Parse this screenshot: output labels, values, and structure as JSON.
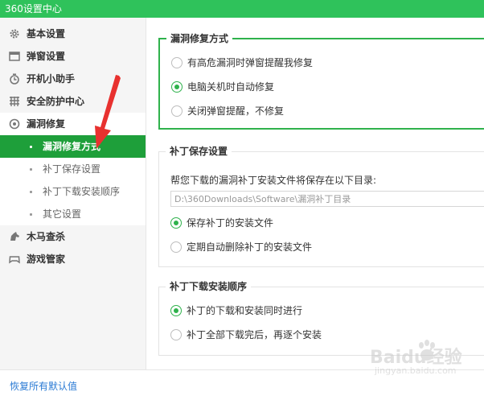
{
  "window": {
    "title": "360设置中心"
  },
  "sidebar": {
    "items": [
      {
        "label": "基本设置",
        "icon": "gear-icon"
      },
      {
        "label": "弹窗设置",
        "icon": "window-icon"
      },
      {
        "label": "开机小助手",
        "icon": "timer-icon"
      },
      {
        "label": "安全防护中心",
        "icon": "shield-grid-icon"
      },
      {
        "label": "漏洞修复",
        "icon": "patch-icon"
      },
      {
        "label": "木马查杀",
        "icon": "horse-icon"
      },
      {
        "label": "游戏管家",
        "icon": "gamepad-icon"
      }
    ],
    "subitems": [
      {
        "label": "漏洞修复方式",
        "active": true
      },
      {
        "label": "补丁保存设置"
      },
      {
        "label": "补丁下载安装顺序"
      },
      {
        "label": "其它设置"
      }
    ]
  },
  "groups": {
    "repair_mode": {
      "title": "漏洞修复方式",
      "options": [
        {
          "label": "有高危漏洞时弹窗提醒我修复",
          "checked": false
        },
        {
          "label": "电脑关机时自动修复",
          "checked": true
        },
        {
          "label": "关闭弹窗提醒，不修复",
          "checked": false
        }
      ]
    },
    "patch_save": {
      "title": "补丁保存设置",
      "description": "帮您下载的漏洞补丁安装文件将保存在以下目录:",
      "path": "D:\\360Downloads\\Software\\漏洞补丁目录",
      "options": [
        {
          "label": "保存补丁的安装文件",
          "checked": true
        },
        {
          "label": "定期自动删除补丁的安装文件",
          "checked": false
        }
      ]
    },
    "download_order": {
      "title": "补丁下载安装顺序",
      "options": [
        {
          "label": "补丁的下载和安装同时进行",
          "checked": true
        },
        {
          "label": "补丁全部下载完后，再逐个安装",
          "checked": false
        }
      ]
    }
  },
  "footer": {
    "restore_link": "恢复所有默认值"
  },
  "watermark": {
    "line1": "Baidu经验",
    "line2": "jingyan.baidu.com"
  },
  "colors": {
    "brand_green": "#2fc25b",
    "active_green": "#1e9f3a",
    "link_blue": "#2a7ad4",
    "arrow_red": "#e8312f"
  }
}
